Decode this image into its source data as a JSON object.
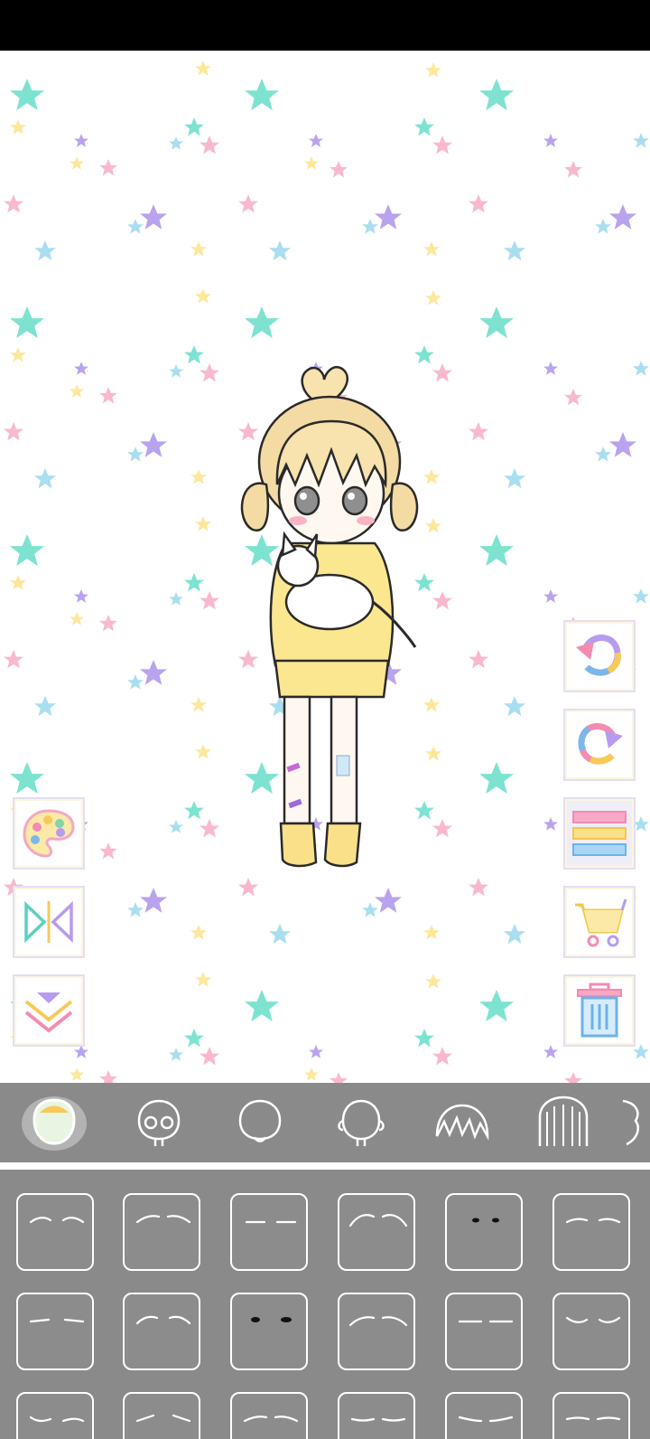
{
  "screen": "eyebrows-selector",
  "colors": {
    "status_bar": "#000000",
    "panel_bg": "#8a8a8a",
    "star_mint": "#7de3d0",
    "star_pink": "#f9b8cf",
    "star_purple": "#b9a3ee",
    "star_yellow": "#fde79a",
    "star_blue": "#a9def0"
  },
  "left_tools": [
    {
      "name": "palette-button",
      "icon": "palette-icon"
    },
    {
      "name": "flip-button",
      "icon": "flip-icon"
    },
    {
      "name": "collapse-button",
      "icon": "chevron-down-double-icon"
    }
  ],
  "right_tools": [
    {
      "name": "undo-button",
      "icon": "undo-icon"
    },
    {
      "name": "redo-button",
      "icon": "redo-icon"
    },
    {
      "name": "layers-button",
      "icon": "layers-icon",
      "active": true
    },
    {
      "name": "shop-button",
      "icon": "cart-icon"
    },
    {
      "name": "delete-button",
      "icon": "trash-icon"
    }
  ],
  "categories": [
    {
      "name": "face-shape",
      "icon": "face-shape-icon",
      "selected": true
    },
    {
      "name": "face",
      "icon": "face-icon"
    },
    {
      "name": "head-chin",
      "icon": "head-chin-icon"
    },
    {
      "name": "head-ears",
      "icon": "head-ears-icon"
    },
    {
      "name": "front-hair",
      "icon": "front-hair-icon"
    },
    {
      "name": "back-hair",
      "icon": "back-hair-icon"
    },
    {
      "name": "side-hair",
      "icon": "side-hair-icon"
    }
  ],
  "eyebrow_options": [
    "brow-01",
    "brow-02",
    "brow-03",
    "brow-04",
    "brow-05",
    "brow-06",
    "brow-07",
    "brow-08",
    "brow-09",
    "brow-10",
    "brow-11",
    "brow-12",
    "brow-13",
    "brow-14",
    "brow-15",
    "brow-16",
    "brow-17",
    "brow-18"
  ]
}
